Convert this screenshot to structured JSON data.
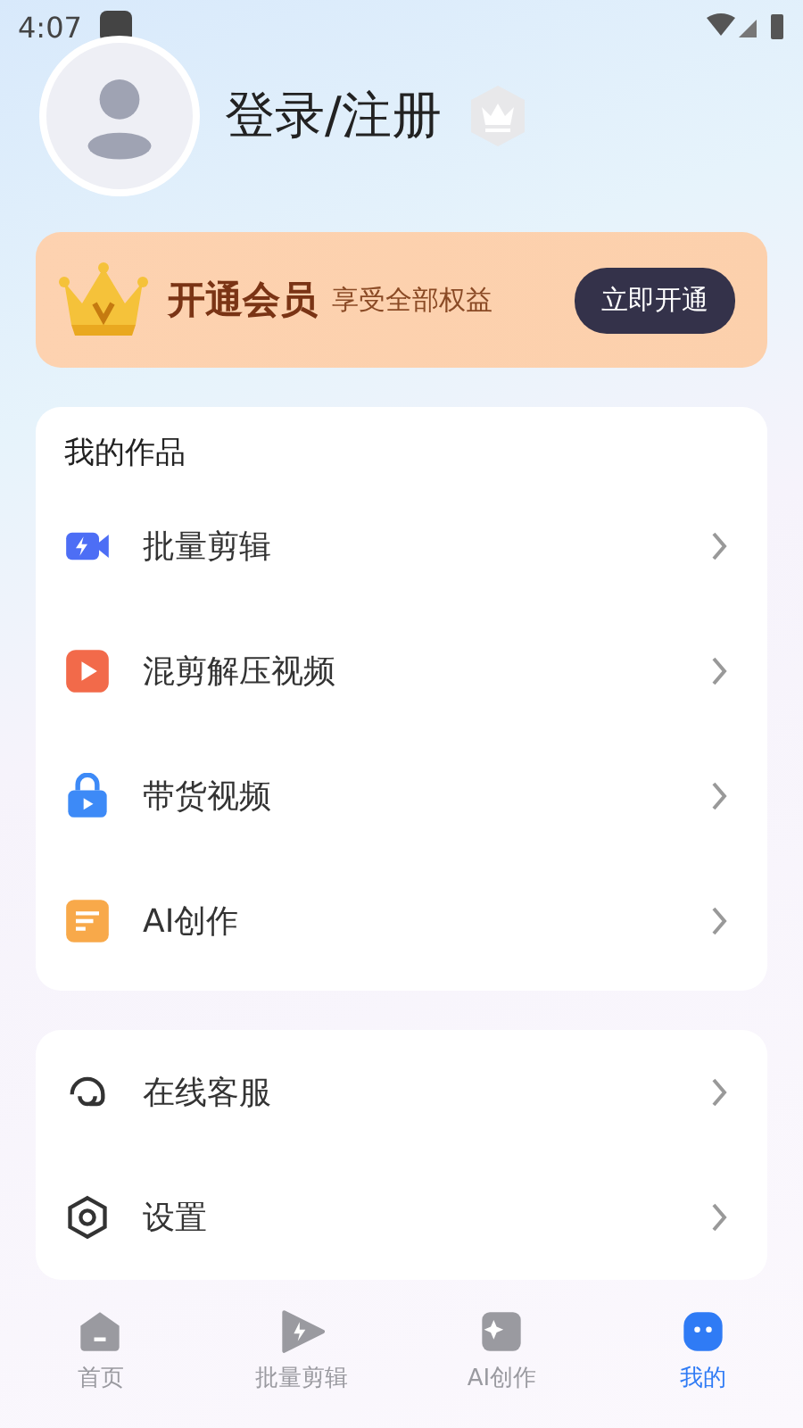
{
  "status_bar": {
    "time": "4:07"
  },
  "profile": {
    "name": "登录/注册"
  },
  "vip_banner": {
    "title": "开通会员",
    "subtitle": "享受全部权益",
    "button": "立即开通"
  },
  "works": {
    "title": "我的作品",
    "items": [
      {
        "kind": "batch",
        "label": "批量剪辑"
      },
      {
        "kind": "play",
        "label": "混剪解压视频"
      },
      {
        "kind": "bag",
        "label": "带货视频"
      },
      {
        "kind": "doc",
        "label": "AI创作"
      }
    ]
  },
  "settings": {
    "items": [
      {
        "kind": "support",
        "label": "在线客服"
      },
      {
        "kind": "gear",
        "label": "设置"
      }
    ]
  },
  "bottom_nav": [
    {
      "kind": "home",
      "label": "首页",
      "selected": false
    },
    {
      "kind": "batch",
      "label": "批量剪辑",
      "selected": false
    },
    {
      "kind": "ai",
      "label": "AI创作",
      "selected": false
    },
    {
      "kind": "me",
      "label": "我的",
      "selected": true
    }
  ]
}
